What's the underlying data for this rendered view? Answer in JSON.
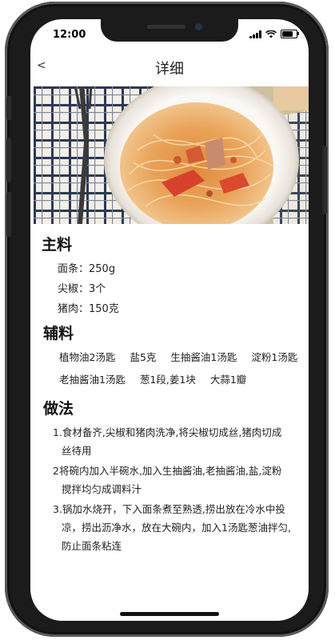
{
  "status_bar": {
    "time": "12:00",
    "icons": [
      "signal-icon",
      "wifi-icon",
      "battery-icon"
    ],
    "battery_level": 0.85
  },
  "nav": {
    "back_label": "<",
    "title": "详细"
  },
  "hero_image": {
    "alt": "spaghetti-dish-photo"
  },
  "main_ingredients": {
    "title": "主料",
    "items": [
      "面条：250g",
      "尖椒：3个",
      "猪肉：150克"
    ]
  },
  "sub_ingredients": {
    "title": "辅料",
    "items": [
      "植物油2汤匙",
      "盐5克",
      "生抽酱油1汤匙",
      "淀粉1汤匙",
      "老抽酱油1汤匙",
      "葱1段,姜1块",
      "大蒜1瓣"
    ]
  },
  "method": {
    "title": "做法",
    "steps": [
      {
        "first": "1.食材备齐,尖椒和猪肉洗净,将尖椒切成丝,猪肉切成",
        "rest": [
          "丝待用"
        ]
      },
      {
        "first": "2将碗内加入半碗水,加入生抽酱油,老抽酱油,盐,淀粉",
        "rest": [
          "搅拌均匀成调料汁"
        ]
      },
      {
        "first": "3.锅加水烧开，下入面条煮至熟透,捞出放在冷水中投",
        "rest": [
          "凉，捞出沥净水，放在大碗内，加入1汤匙葱油拌匀,",
          "防止面条粘连"
        ]
      }
    ]
  },
  "colors": {
    "device_frame": "#1b1b1b",
    "screen_bg": "#ffffff",
    "text": "#222222"
  }
}
